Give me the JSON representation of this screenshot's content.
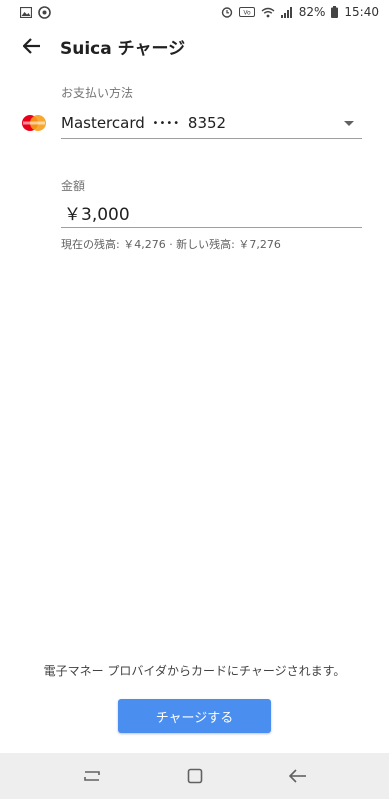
{
  "status_bar": {
    "battery": "82%",
    "time": "15:40",
    "icons": [
      "image-icon",
      "sync-icon",
      "alarm-icon",
      "volte-icon",
      "wifi-icon",
      "signal-icon",
      "battery-icon"
    ]
  },
  "app_bar": {
    "title": "Suica チャージ",
    "back_icon": "arrow-left-icon"
  },
  "payment": {
    "label": "お支払い方法",
    "card_name": "Mastercard",
    "card_dots": "••••",
    "card_last4": "8352",
    "dropdown_icon": "triangle-down-icon",
    "logo_colors": {
      "red": "#eb001b",
      "orange": "#f79e1b"
    }
  },
  "amount": {
    "label": "金額",
    "value": "￥3,000",
    "balance_info": "現在の残高: ￥4,276 · 新しい残高: ￥7,276"
  },
  "footer": {
    "notice": "電子マネー プロバイダからカードにチャージされます。",
    "charge_button": "チャージする",
    "accent": "#4a8ef0"
  },
  "nav_bar": {
    "icons": [
      "recents-icon",
      "home-icon",
      "back-icon"
    ]
  }
}
